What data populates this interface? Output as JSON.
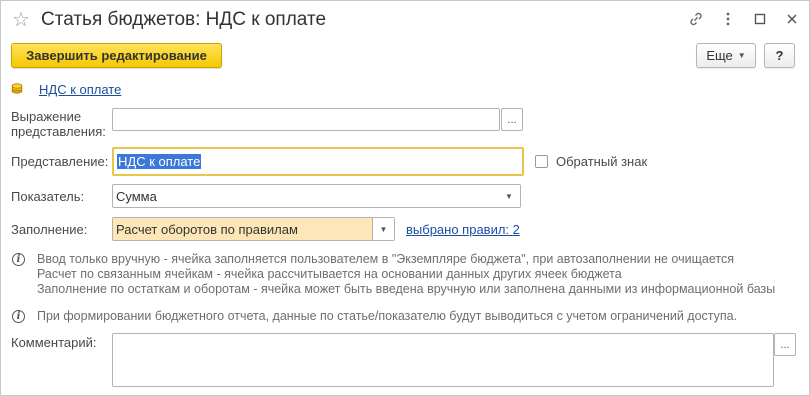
{
  "window": {
    "title": "Статья бюджетов: НДС к оплате",
    "icons": [
      "link-icon",
      "more-vert-icon",
      "maximize-icon",
      "close-icon"
    ]
  },
  "toolbar": {
    "finish_label": "Завершить редактирование",
    "more_label": "Еще",
    "help_label": "?"
  },
  "breadcrumb_link": "НДС к оплате",
  "form": {
    "expression_label_line1": "Выражение",
    "expression_label_line2": "представления:",
    "expression_value": "",
    "expression_button": "...",
    "presentation_label": "Представление:",
    "presentation_value": "НДС к оплате",
    "reverse_sign_label": "Обратный знак",
    "reverse_sign_checked": false,
    "indicator_label": "Показатель:",
    "indicator_value": "Сумма",
    "fill_label": "Заполнение:",
    "fill_value": "Расчет оборотов по правилам",
    "rules_link": "выбрано правил: 2",
    "comment_label": "Комментарий:",
    "comment_value": "",
    "comment_button": "..."
  },
  "info": {
    "line1": "Ввод только вручную - ячейка заполняется пользователем в \"Экземпляре бюджета\", при автозаполнении не очищается",
    "line2": "Расчет по связанным ячейкам - ячейка рассчитывается на основании данных других ячеек бюджета",
    "line3": "Заполнение по остаткам и оборотам - ячейка может быть введена вручную или заполнена данными из информационной базы",
    "line4": "При формировании бюджетного отчета, данные по статье/показателю будут выводиться с учетом ограничений доступа."
  },
  "colors": {
    "accent_yellow": "#f5c800",
    "focus_border": "#e8c54a",
    "fill_field_bg": "#fde7b8",
    "link": "#1a4fa0"
  }
}
